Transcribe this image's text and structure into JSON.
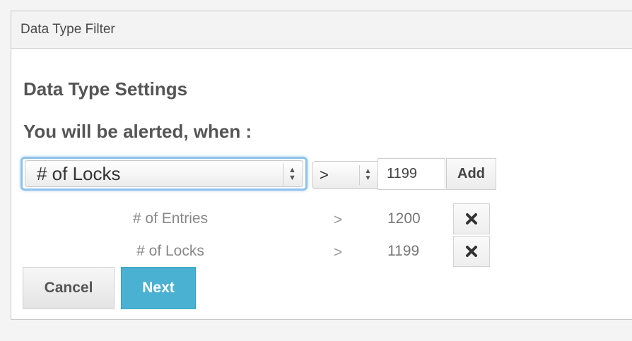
{
  "dialog": {
    "title": "Data Type Filter"
  },
  "settings": {
    "heading": "Data Type Settings",
    "alert_text": "You will be alerted, when :"
  },
  "new_rule": {
    "field_value": "# of Locks",
    "operator_value": ">",
    "threshold_value": "1199",
    "add_label": "Add"
  },
  "rules": [
    {
      "field": "# of Entries",
      "operator": ">",
      "value": "1200",
      "remove_icon": "close-icon"
    },
    {
      "field": "# of Locks",
      "operator": ">",
      "value": "1199",
      "remove_icon": "close-icon"
    }
  ],
  "actions": {
    "cancel_label": "Cancel",
    "next_label": "Next"
  },
  "colors": {
    "accent": "#4bb1d3",
    "focus_ring": "#8ec3ea"
  }
}
